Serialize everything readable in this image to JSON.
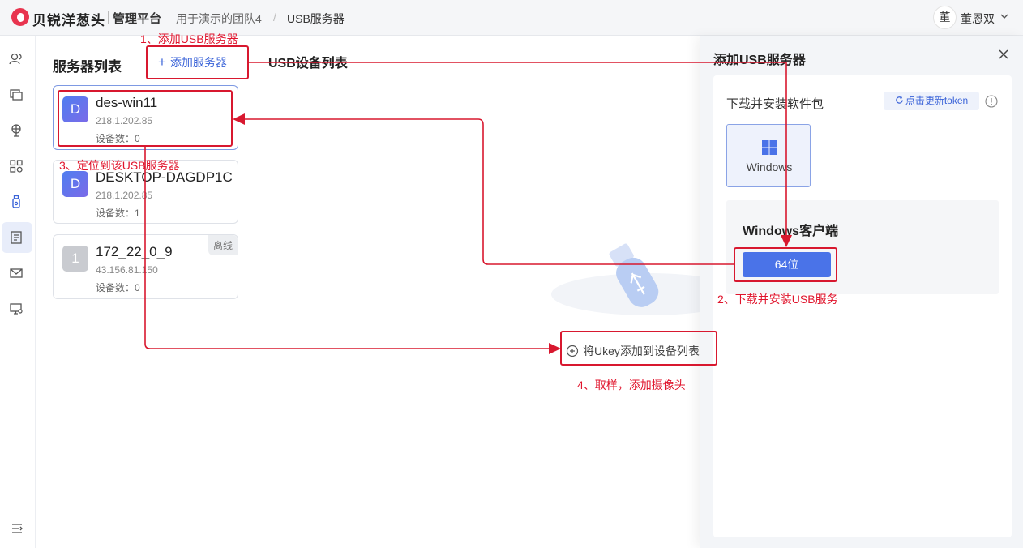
{
  "header": {
    "brand": "贝锐洋葱头",
    "platform": "管理平台",
    "breadcrumb": [
      "用于演示的团队4",
      "/",
      "USB服务器"
    ],
    "user_avatar": "董",
    "user_name": "董恩双"
  },
  "server_panel": {
    "title": "服务器列表",
    "add_label": "添加服务器",
    "servers": [
      {
        "avatar": "D",
        "name": "des-win11",
        "ip": "218.1.202.85",
        "count": "设备数：0",
        "status": ""
      },
      {
        "avatar": "D",
        "name": "DESKTOP-DAGDP1C",
        "ip": "218.1.202.85",
        "count": "设备数：1",
        "status": ""
      },
      {
        "avatar": "1",
        "name": "172_22_0_9",
        "ip": "43.156.81.150",
        "count": "设备数：0",
        "status": "离线"
      }
    ]
  },
  "device_area": {
    "title": "USB设备列表",
    "add_ukey_label": "将Ukey添加到设备列表"
  },
  "drawer": {
    "title": "添加USB服务器",
    "download_label": "下载并安装软件包",
    "token_label": "点击更新token",
    "os_option": "Windows",
    "client_title": "Windows客户端",
    "download_button": "64位"
  },
  "annotations": {
    "step1": "1、添加USB服务器",
    "step2": "2、下载并安装USB服务",
    "step3": "3、定位到该USB服务器",
    "step4": "4、取样，添加摄像头"
  },
  "colors": {
    "accent": "#4a73e8",
    "annotation": "#d8182f"
  }
}
